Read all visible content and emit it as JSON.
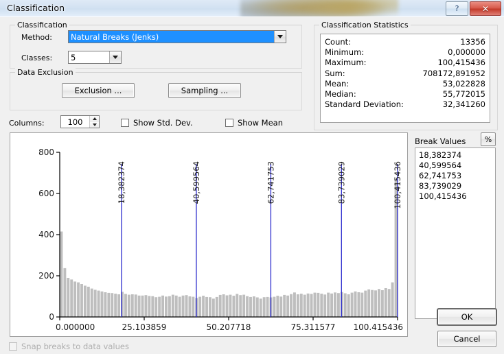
{
  "window": {
    "title": "Classification",
    "help_label": "?",
    "close_label": "✕"
  },
  "classification_group": {
    "legend": "Classification",
    "method_label": "Method:",
    "method_value": "Natural Breaks (Jenks)",
    "classes_label": "Classes:",
    "classes_value": "5"
  },
  "data_exclusion_group": {
    "legend": "Data Exclusion",
    "exclusion_button": "Exclusion ...",
    "sampling_button": "Sampling ..."
  },
  "options_row": {
    "columns_label": "Columns:",
    "columns_value": "100",
    "show_std_dev": "Show Std. Dev.",
    "show_mean": "Show Mean"
  },
  "statistics": {
    "legend": "Classification Statistics",
    "rows": [
      {
        "key": "Count:",
        "value": "13356"
      },
      {
        "key": "Minimum:",
        "value": "0,000000"
      },
      {
        "key": "Maximum:",
        "value": "100,415436"
      },
      {
        "key": "Sum:",
        "value": "708172,891952"
      },
      {
        "key": "Mean:",
        "value": "53,022828"
      },
      {
        "key": "Median:",
        "value": "55,772015"
      },
      {
        "key": "Standard Deviation:",
        "value": "32,341260"
      }
    ]
  },
  "break_values_panel": {
    "label": "Break Values",
    "percent_button": "%",
    "items": [
      "18,382374",
      "40,599564",
      "62,741753",
      "83,739029",
      "100,415436"
    ]
  },
  "footer": {
    "snap_checkbox": "Snap breaks to data values",
    "ok_button": "OK",
    "cancel_button": "Cancel"
  },
  "colors": {
    "bar": "#bebebe",
    "break_line": "#2b2bcd",
    "selection": "#1e90ff",
    "axis": "#000000",
    "dialog_bg": "#f0f0f0"
  },
  "chart_data": {
    "type": "bar",
    "title": "",
    "xlabel": "",
    "ylabel": "",
    "xlim": [
      0,
      100.415436
    ],
    "ylim": [
      0,
      800
    ],
    "grid": false,
    "legend": "none",
    "x_tick_labels": [
      "0.000000",
      "25.103859",
      "50.207718",
      "75.311577",
      "100.415436"
    ],
    "x_tick_values": [
      0,
      25.103859,
      50.207718,
      75.311577,
      100.415436
    ],
    "y_tick_labels": [
      "0",
      "200",
      "400",
      "600",
      "800"
    ],
    "y_tick_values": [
      0,
      200,
      400,
      600,
      800
    ],
    "bin_count": 100,
    "break_lines": [
      {
        "value": 18.382374,
        "label": "18,382374"
      },
      {
        "value": 40.599564,
        "label": "40,599564"
      },
      {
        "value": 62.741753,
        "label": "62,741753"
      },
      {
        "value": 83.739029,
        "label": "83,739029"
      },
      {
        "value": 100.415436,
        "label": "100,415436"
      }
    ],
    "values": [
      415,
      237,
      190,
      182,
      172,
      168,
      160,
      152,
      147,
      138,
      132,
      128,
      124,
      120,
      117,
      116,
      113,
      110,
      122,
      112,
      108,
      110,
      109,
      104,
      104,
      106,
      102,
      101,
      96,
      98,
      104,
      99,
      101,
      108,
      104,
      98,
      104,
      106,
      100,
      98,
      92,
      98,
      103,
      97,
      96,
      89,
      97,
      107,
      110,
      105,
      108,
      103,
      112,
      106,
      108,
      101,
      97,
      100,
      95,
      89,
      96,
      97,
      95,
      98,
      103,
      99,
      107,
      104,
      111,
      119,
      110,
      113,
      108,
      114,
      112,
      118,
      117,
      113,
      109,
      118,
      114,
      119,
      116,
      121,
      115,
      110,
      118,
      124,
      120,
      118,
      128,
      134,
      131,
      129,
      136,
      130,
      140,
      136,
      168,
      670
    ]
  }
}
